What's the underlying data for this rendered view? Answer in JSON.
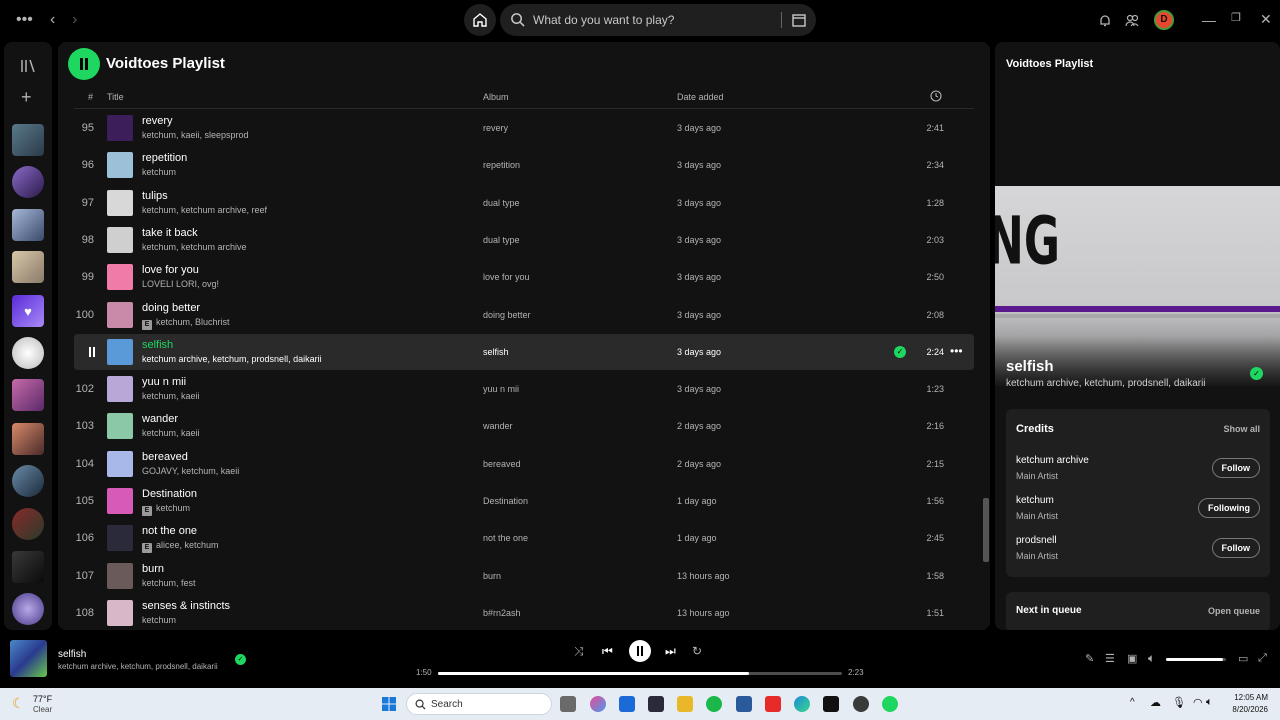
{
  "topbar": {
    "search_placeholder": "What do you want to play?",
    "avatar_letter": "D"
  },
  "playlist": {
    "title": "Voidtoes Playlist",
    "headers": {
      "num": "#",
      "title": "Title",
      "album": "Album",
      "date_added": "Date added"
    },
    "rows": [
      {
        "num": "95",
        "title": "revery",
        "artists": "ketchum, kaeii, sleepsprod",
        "explicit": false,
        "album": "revery",
        "date": "3 days ago",
        "duration": "2:41",
        "art": "#3c1f5a"
      },
      {
        "num": "96",
        "title": "repetition",
        "artists": "ketchum",
        "explicit": false,
        "album": "repetition",
        "date": "3 days ago",
        "duration": "2:34",
        "art": "#9cc0d8"
      },
      {
        "num": "97",
        "title": "tulips",
        "artists": "ketchum, ketchum archive, reef",
        "explicit": false,
        "album": "dual type",
        "date": "3 days ago",
        "duration": "1:28",
        "art": "#d8d8d8"
      },
      {
        "num": "98",
        "title": "take it back",
        "artists": "ketchum, ketchum archive",
        "explicit": false,
        "album": "dual type",
        "date": "3 days ago",
        "duration": "2:03",
        "art": "#cfcfcf"
      },
      {
        "num": "99",
        "title": "love for you",
        "artists": "LOVELI LORI, ovg!",
        "explicit": false,
        "album": "love for you",
        "date": "3 days ago",
        "duration": "2:50",
        "art": "#f07aa8"
      },
      {
        "num": "100",
        "title": "doing better",
        "artists": "ketchum, Bluchrist",
        "explicit": true,
        "album": "doing better",
        "date": "3 days ago",
        "duration": "2:08",
        "art": "#c88aa8"
      },
      {
        "num": "",
        "title": "selfish",
        "artists": "ketchum archive, ketchum, prodsnell, daikarii",
        "explicit": false,
        "album": "selfish",
        "date": "3 days ago",
        "duration": "2:24",
        "art": "#5a9ad8",
        "active": true
      },
      {
        "num": "102",
        "title": "yuu n mii",
        "artists": "ketchum, kaeii",
        "explicit": false,
        "album": "yuu n mii",
        "date": "3 days ago",
        "duration": "1:23",
        "art": "#b8a8d8"
      },
      {
        "num": "103",
        "title": "wander",
        "artists": "ketchum, kaeii",
        "explicit": false,
        "album": "wander",
        "date": "2 days ago",
        "duration": "2:16",
        "art": "#8ac8a8"
      },
      {
        "num": "104",
        "title": "bereaved",
        "artists": "GOJAVY, ketchum, kaeii",
        "explicit": false,
        "album": "bereaved",
        "date": "2 days ago",
        "duration": "2:15",
        "art": "#a8b8e8"
      },
      {
        "num": "105",
        "title": "Destination",
        "artists": "ketchum",
        "explicit": true,
        "album": "Destination",
        "date": "1 day ago",
        "duration": "1:56",
        "art": "#d85ab8"
      },
      {
        "num": "106",
        "title": "not the one",
        "artists": "alicee, ketchum",
        "explicit": true,
        "album": "not the one",
        "date": "1 day ago",
        "duration": "2:45",
        "art": "#2a2a3a"
      },
      {
        "num": "107",
        "title": "burn",
        "artists": "ketchum, fest",
        "explicit": false,
        "album": "burn",
        "date": "13 hours ago",
        "duration": "1:58",
        "art": "#6a5a5a"
      },
      {
        "num": "108",
        "title": "senses & instincts",
        "artists": "ketchum",
        "explicit": false,
        "album": "b#rn2ash",
        "date": "13 hours ago",
        "duration": "1:51",
        "art": "#d8b8c8"
      }
    ]
  },
  "right_panel": {
    "title": "Voidtoes Playlist",
    "song": "selfish",
    "artists": "ketchum archive, ketchum, prodsnell, daikarii",
    "cover_text": "NG",
    "credits_title": "Credits",
    "show_all": "Show all",
    "credits": [
      {
        "name": "ketchum archive",
        "role": "Main Artist",
        "button": "Follow"
      },
      {
        "name": "ketchum",
        "role": "Main Artist",
        "button": "Following"
      },
      {
        "name": "prodsnell",
        "role": "Main Artist",
        "button": "Follow"
      }
    ],
    "queue_title": "Next in queue",
    "open_queue": "Open queue"
  },
  "player": {
    "title": "selfish",
    "artists": "ketchum archive, ketchum, prodsnell, daikarii",
    "elapsed": "1:50",
    "total": "2:23",
    "progress_fraction": 0.77,
    "volume_fraction": 0.95
  },
  "taskbar": {
    "temp": "77°F",
    "condition": "Clear",
    "search": "Search",
    "time": "12:05 AM",
    "date": "8/20/2026"
  },
  "colors": {
    "accent": "#1ed760",
    "bg": "#121212"
  }
}
